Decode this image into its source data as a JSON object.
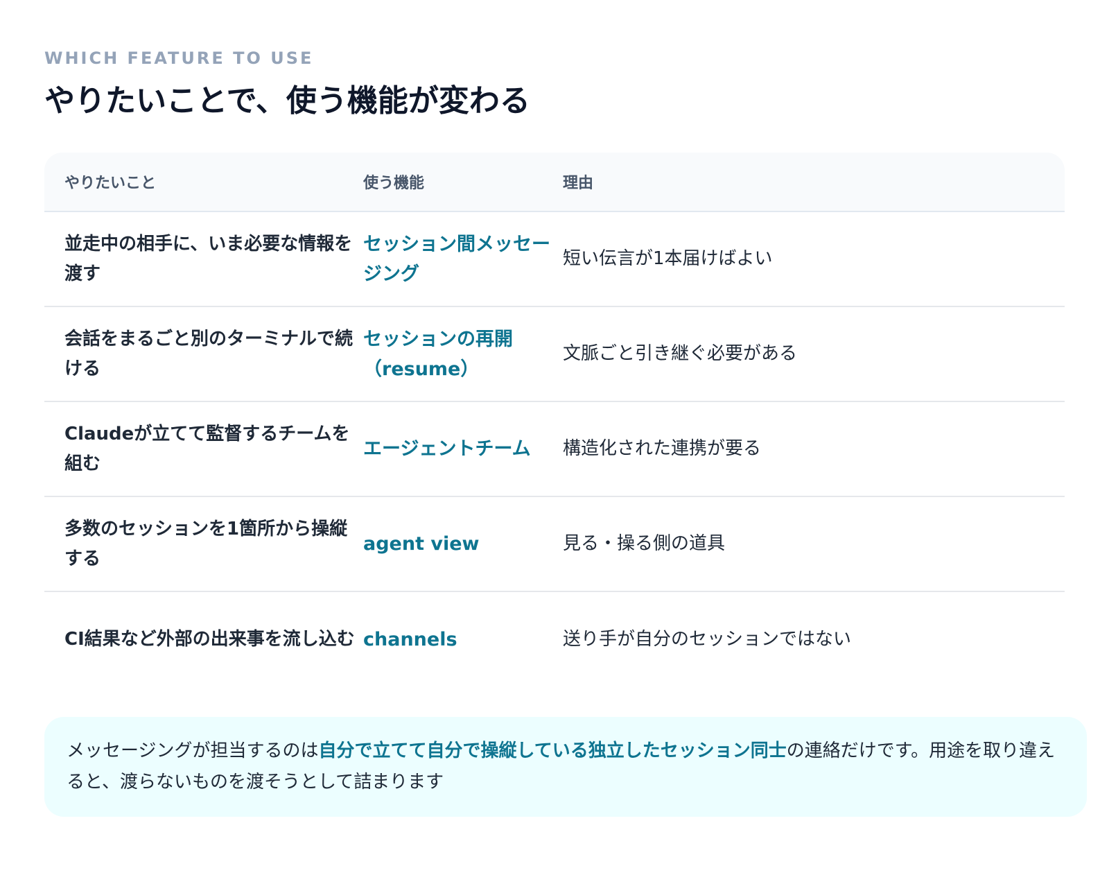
{
  "header": {
    "eyebrow": "WHICH FEATURE TO USE",
    "title": "やりたいことで、使う機能が変わる"
  },
  "table": {
    "columns": [
      "やりたいこと",
      "使う機能",
      "理由"
    ],
    "rows": [
      {
        "want": "並走中の相手に、いま必要な情報を渡す",
        "feature": "セッション間メッセージング",
        "reason": "短い伝言が1本届けばよい"
      },
      {
        "want": "会話をまるごと別のターミナルで続ける",
        "feature": "セッションの再開（resume）",
        "reason": "文脈ごと引き継ぐ必要がある"
      },
      {
        "want": "Claudeが立てて監督するチームを組む",
        "feature": "エージェントチーム",
        "reason": "構造化された連携が要る"
      },
      {
        "want": "多数のセッションを1箇所から操縦する",
        "feature": "agent view",
        "reason": "見る・操る側の道具"
      },
      {
        "want": "CI結果など外部の出来事を流し込む",
        "feature": "channels",
        "reason": "送り手が自分のセッションではない"
      }
    ]
  },
  "note": {
    "before": "メッセージングが担当するのは",
    "highlight": "自分で立てて自分で操縦している独立したセッション同士",
    "after": "の連絡だけです。用途を取り違えると、渡らないものを渡そうとして詰まります"
  },
  "colors": {
    "accent": "#0e7490",
    "note_bg": "#ecfeff",
    "header_bg": "#f8fafc",
    "eyebrow": "#94a3b8"
  }
}
